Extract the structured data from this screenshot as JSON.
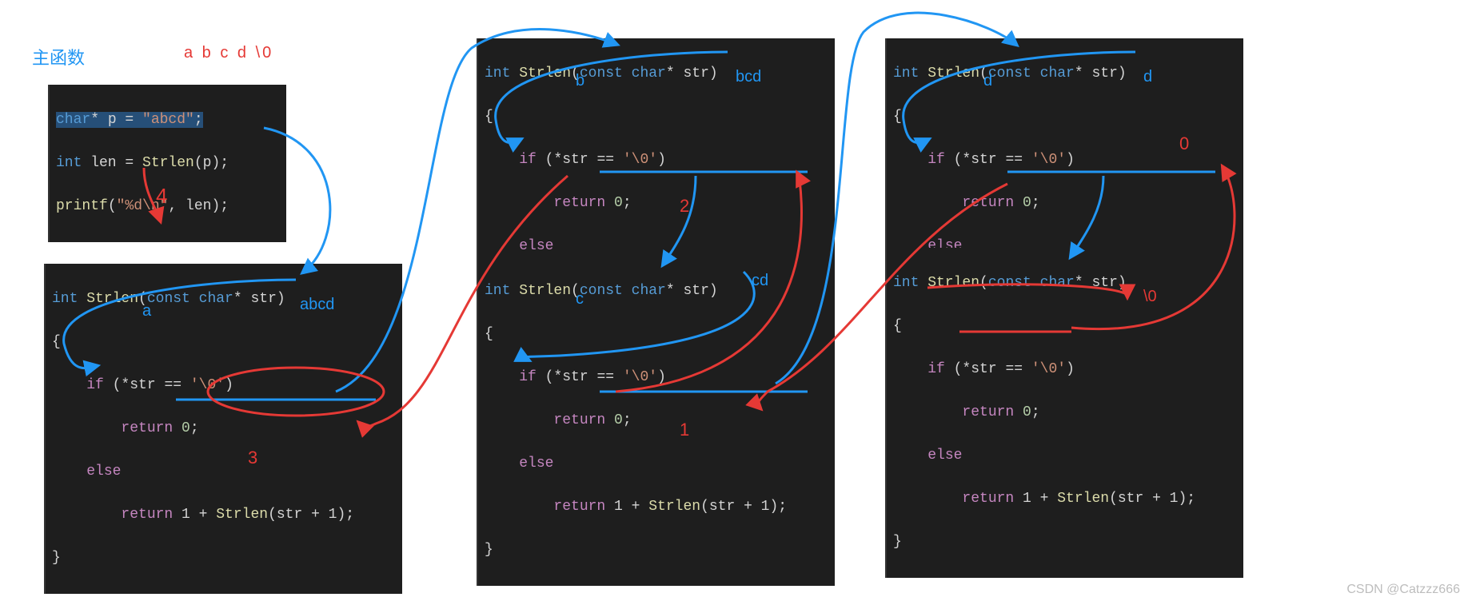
{
  "title": "主函数",
  "header_string": "a b c d \\0",
  "watermark": "CSDN @Catzzz666",
  "code_main": {
    "l1_pre": "char",
    "l1_mid": "* p = ",
    "l1_str": "\"abcd\"",
    "l1_end": ";",
    "l2_kw": "int",
    "l2_var1": " len = ",
    "l2_fn": "Strlen",
    "l2_p": "(p);",
    "l3_fn": "printf",
    "l3_a": "(",
    "l3_str": "\"%d\\n\"",
    "l3_b": ", len);"
  },
  "fn_sig": {
    "kw1": "int",
    "name": " Strlen",
    "p1": "(",
    "kw2": "const char",
    "p2": "* str)"
  },
  "body": {
    "brace_o": "{",
    "if_kw": "if",
    "if_cond_a": " (*str == ",
    "if_cond_b": "'\\0'",
    "if_cond_c": ")",
    "ret0_kw": "return",
    "ret0_v": " 0",
    "ret0_e": ";",
    "else_kw": "else",
    "ret1_kw": "return",
    "ret1_a": " 1 + ",
    "ret1_fn": "Strlen",
    "ret1_b": "(str + 1);",
    "brace_c": "}"
  },
  "hints": {
    "box1_letter": "a",
    "box1_param": "abcd",
    "box2_letter": "b",
    "box2_param": "bcd",
    "box3_letter": "c",
    "box3_param": "cd",
    "box4_letter": "d",
    "box4_param": "d",
    "box5_param": "\\0"
  },
  "returns": {
    "r1": "1",
    "r2": "2",
    "r3": "3",
    "r4": "0",
    "main": "4"
  }
}
